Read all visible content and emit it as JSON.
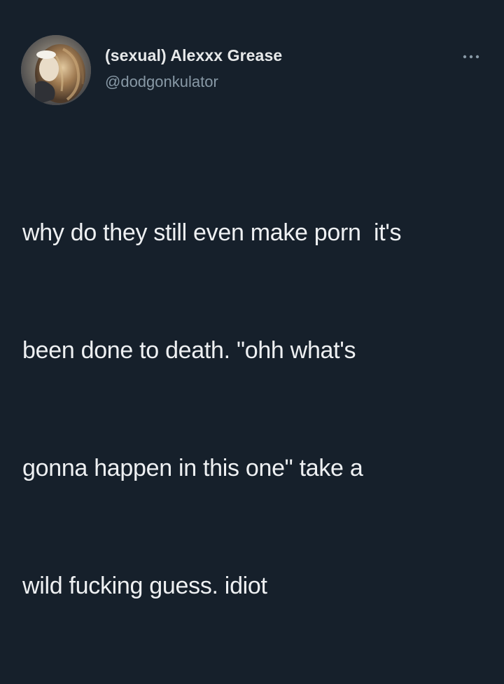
{
  "tweet": {
    "author": {
      "display_name": "(sexual) Alexxx Grease",
      "handle": "@dodgonkulator",
      "avatar_icon": "profile-photo-avatar"
    },
    "more_icon": "ellipsis-icon",
    "text_lines": [
      "why do they still even make porn  it's",
      "been done to death. \"ohh what's",
      "gonna happen in this one\" take a",
      "wild fucking guess. idiot"
    ],
    "colors": {
      "background": "#16202b",
      "text": "#e7e9ea",
      "secondary_text": "#8899a6"
    }
  }
}
